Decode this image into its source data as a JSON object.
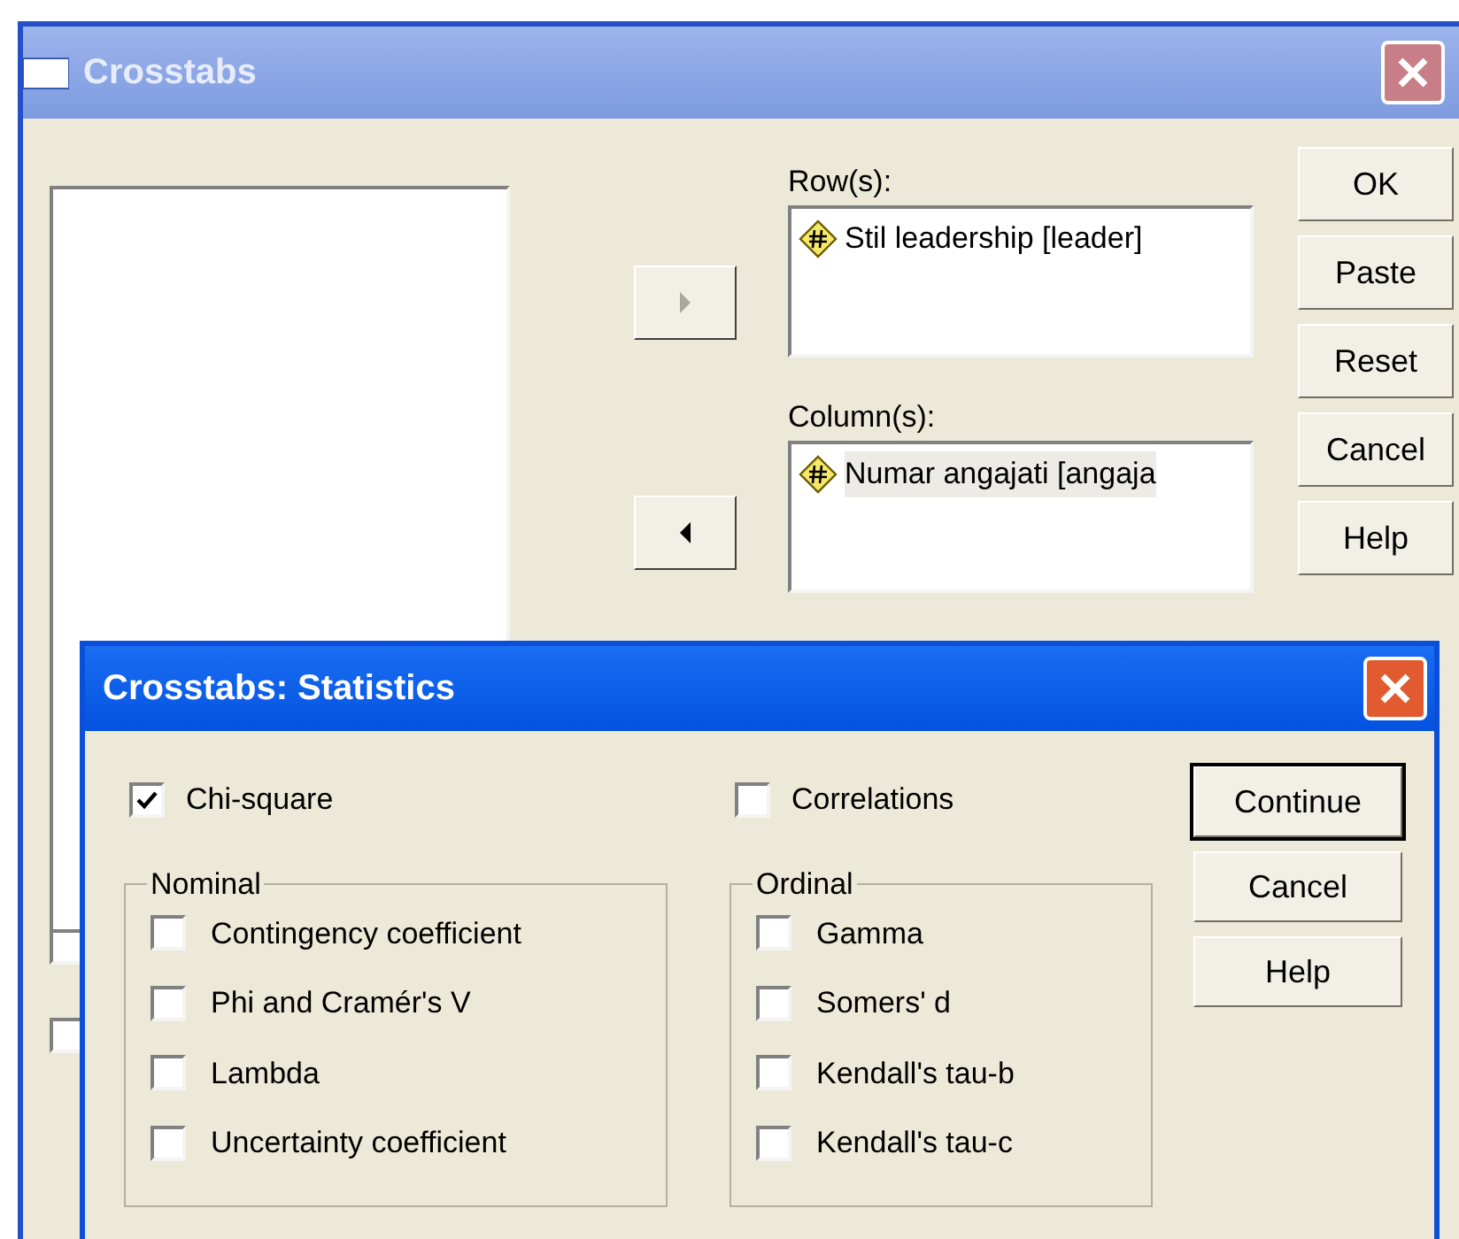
{
  "main_dialog": {
    "title": "Crosstabs",
    "move_buttons": [
      {
        "kind": "right",
        "disabled": true
      },
      {
        "kind": "left",
        "disabled": false
      }
    ],
    "rows": {
      "label": "Row(s):",
      "items": [
        {
          "text": "Stil leadership [leader]",
          "selected": false
        }
      ]
    },
    "columns": {
      "label": "Column(s):",
      "items": [
        {
          "text": "Numar angajati [angaja",
          "selected": true
        }
      ]
    },
    "buttons": [
      "OK",
      "Paste",
      "Reset",
      "Cancel",
      "Help"
    ],
    "partial_checkboxes": [
      {
        "checked": false
      },
      {
        "checked": false
      }
    ]
  },
  "statistics_dialog": {
    "title": "Crosstabs: Statistics",
    "chi_square": {
      "label": "Chi-square",
      "checked": true
    },
    "correlations": {
      "label": "Correlations",
      "checked": false
    },
    "groups": [
      {
        "title": "Nominal",
        "options": [
          {
            "label": "Contingency coefficient",
            "checked": false
          },
          {
            "label": "Phi and Cramér's V",
            "checked": false
          },
          {
            "label": "Lambda",
            "checked": false
          },
          {
            "label": "Uncertainty coefficient",
            "checked": false
          }
        ]
      },
      {
        "title": "Ordinal",
        "options": [
          {
            "label": "Gamma",
            "checked": false
          },
          {
            "label": "Somers' d",
            "checked": false
          },
          {
            "label": "Kendall's tau-b",
            "checked": false
          },
          {
            "label": "Kendall's tau-c",
            "checked": false
          }
        ]
      }
    ],
    "buttons": [
      {
        "label": "Continue",
        "default": true
      },
      {
        "label": "Cancel",
        "default": false
      },
      {
        "label": "Help",
        "default": false
      }
    ]
  }
}
